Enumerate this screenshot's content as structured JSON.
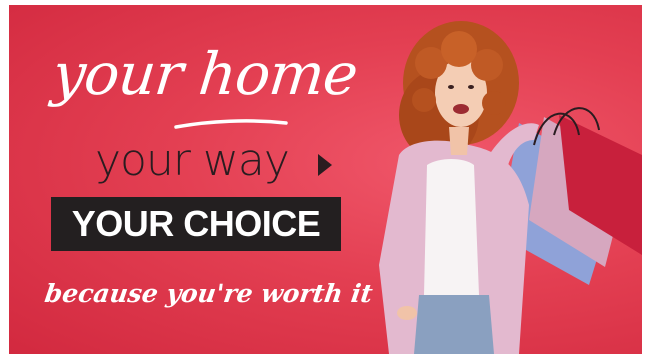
{
  "banner": {
    "headline_script": "your home",
    "subline": "your way",
    "choice_label": "YOUR CHOICE",
    "tagline": "because you're worth it",
    "colors": {
      "background": "#e33f52",
      "box": "#231f20",
      "dark_text": "#2a1c20",
      "light_text": "#ffffff"
    },
    "icons": [
      "play-arrow-icon"
    ],
    "photo_subject": "woman-with-shopping-bags"
  }
}
